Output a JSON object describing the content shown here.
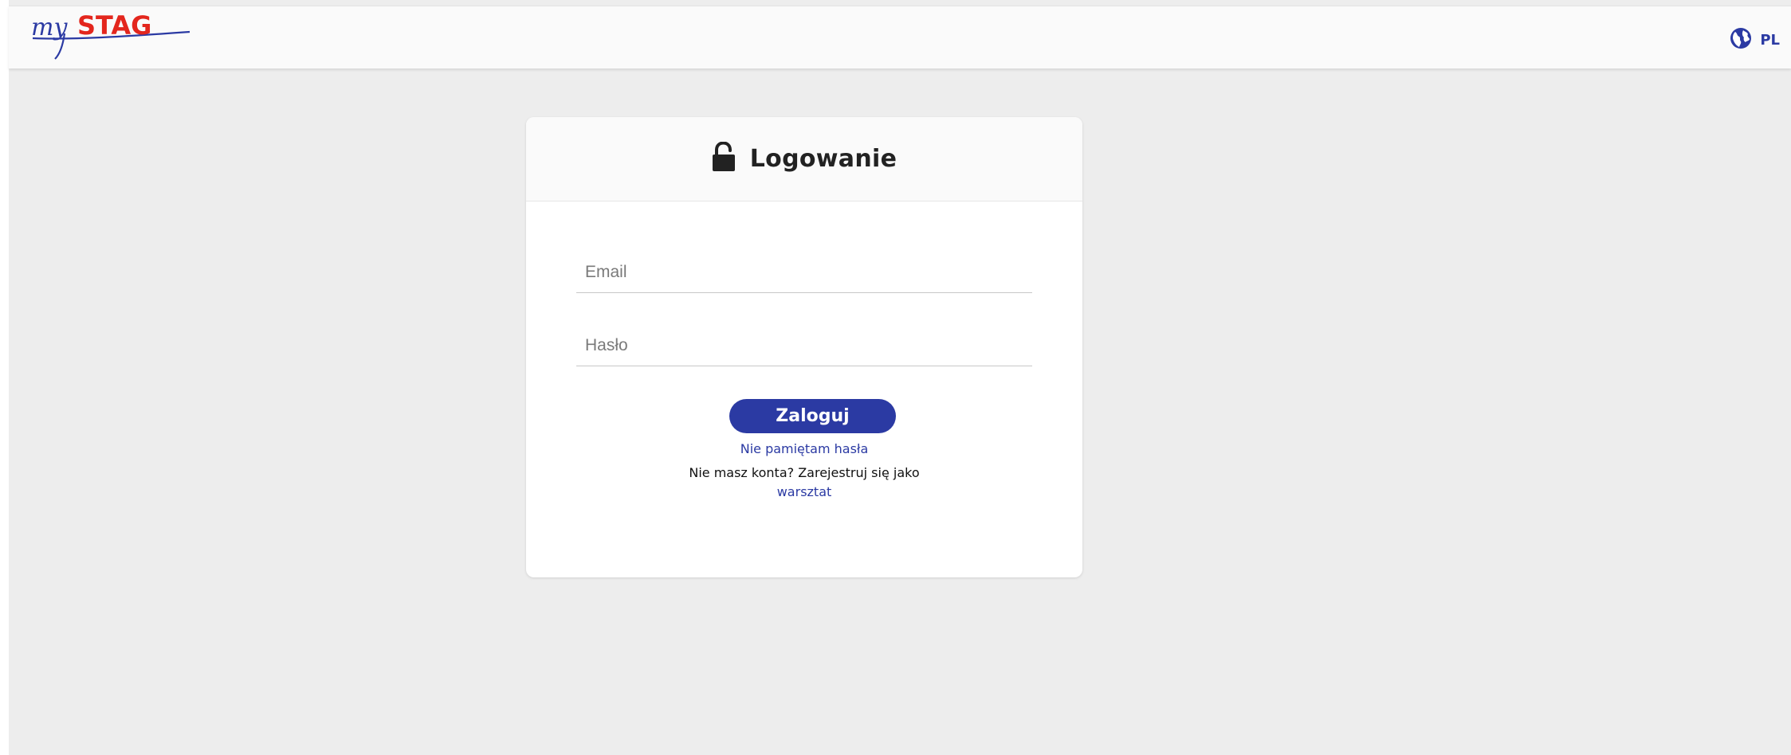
{
  "header": {
    "logo_text_script": "my",
    "logo_text_brand": "STAG",
    "language": "PL",
    "globe_icon": "globe-icon"
  },
  "login": {
    "icon": "unlock-icon",
    "title": "Logowanie",
    "email_placeholder": "Email",
    "email_value": "",
    "password_placeholder": "Hasło",
    "password_value": "",
    "submit_label": "Zaloguj",
    "forgot_password_link": "Nie pamiętam hasła",
    "register_prompt": "Nie masz konta? Zarejestruj się jako",
    "register_link": "warsztat"
  },
  "colors": {
    "brand_blue": "#2b3aa3",
    "brand_red": "#e3261d",
    "page_background": "#ededed",
    "card_background": "#ffffff"
  }
}
